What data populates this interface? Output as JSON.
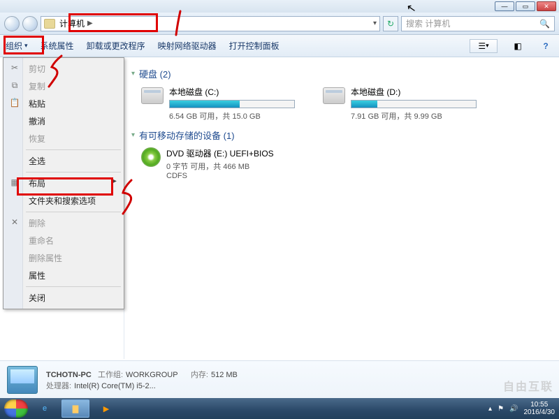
{
  "address": {
    "location": "计算机",
    "search_placeholder": "搜索 计算机"
  },
  "toolbar": {
    "organize": "组织",
    "sysprops": "系统属性",
    "uninstall": "卸载或更改程序",
    "mapdrive": "映射网络驱动器",
    "ctrlpanel": "打开控制面板"
  },
  "organize_menu": {
    "cut": "剪切",
    "copy": "复制",
    "paste": "粘贴",
    "undo": "撤消",
    "redo": "恢复",
    "selectall": "全选",
    "layout": "布局",
    "folderopts": "文件夹和搜索选项",
    "delete": "删除",
    "rename": "重命名",
    "removeprops": "删除属性",
    "properties": "属性",
    "close": "关闭"
  },
  "sections": {
    "hdd": {
      "title": "硬盘 (2)"
    },
    "removable": {
      "title": "有可移动存储的设备 (1)"
    }
  },
  "drives": {
    "c": {
      "title": "本地磁盘 (C:)",
      "text": "6.54 GB 可用，共 15.0 GB",
      "fill_pct": 56
    },
    "d": {
      "title": "本地磁盘 (D:)",
      "text": "7.91 GB 可用，共 9.99 GB",
      "fill_pct": 21
    }
  },
  "dvd": {
    "title": "DVD 驱动器 (E:) UEFI+BIOS",
    "line2": "0 字节 可用，共 466 MB",
    "line3": "CDFS"
  },
  "details": {
    "pcname": "TCHOTN-PC",
    "workgroup_lbl": "工作组:",
    "workgroup": "WORKGROUP",
    "mem_lbl": "内存:",
    "mem": "512 MB",
    "cpu_lbl": "处理器:",
    "cpu": "Intel(R) Core(TM) i5-2..."
  },
  "tray": {
    "time": "10:55",
    "date": "2016/4/30"
  },
  "watermark": "自由互联"
}
